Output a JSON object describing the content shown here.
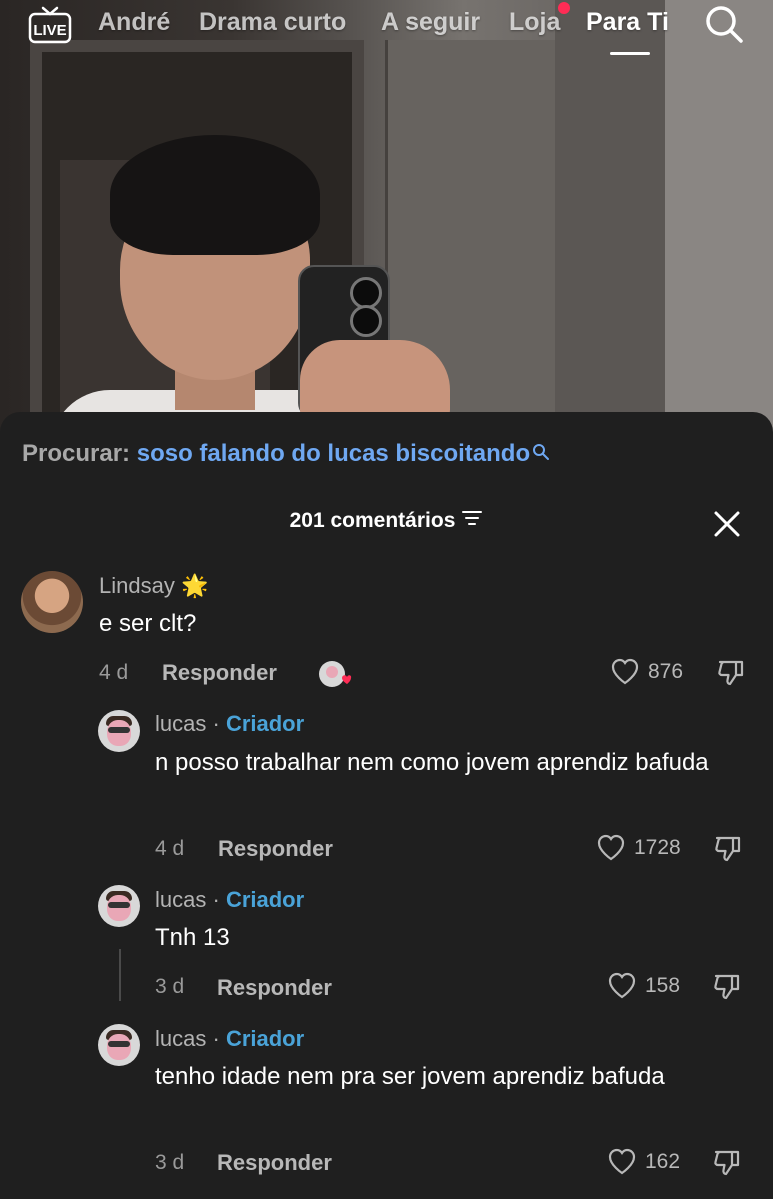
{
  "top_nav": {
    "tabs": [
      "André",
      "Drama curto",
      "A seguir",
      "Loja",
      "Para Ti"
    ],
    "active_tab": "Para Ti",
    "live_label": "LIVE",
    "shop_badge_color": "#fe2c55"
  },
  "comments_sheet": {
    "search_label": "Procurar:",
    "search_query": "soso falando do lucas biscoitando",
    "count_label": "201 comentários",
    "accent_link_color": "#6fa8f2",
    "creator_color": "#4aa3d8",
    "comments": [
      {
        "user": "Lindsay",
        "badge": "🌟",
        "text": "e ser clt?",
        "age": "4 d",
        "reply_label": "Responder",
        "likes": "876",
        "creator_liked": true
      },
      {
        "user": "lucas",
        "separator": "·",
        "role": "Criador",
        "text": "n posso trabalhar nem como jovem aprendiz bafuda",
        "age": "4 d",
        "reply_label": "Responder",
        "likes": "1728"
      },
      {
        "user": "lucas",
        "separator": "·",
        "role": "Criador",
        "text": "Tnh 13",
        "age": "3 d",
        "reply_label": "Responder",
        "likes": "158"
      },
      {
        "user": "lucas",
        "separator": "·",
        "role": "Criador",
        "text": "tenho idade nem pra ser jovem aprendiz bafuda",
        "age": "3 d",
        "reply_label": "Responder",
        "likes": "162"
      }
    ]
  }
}
